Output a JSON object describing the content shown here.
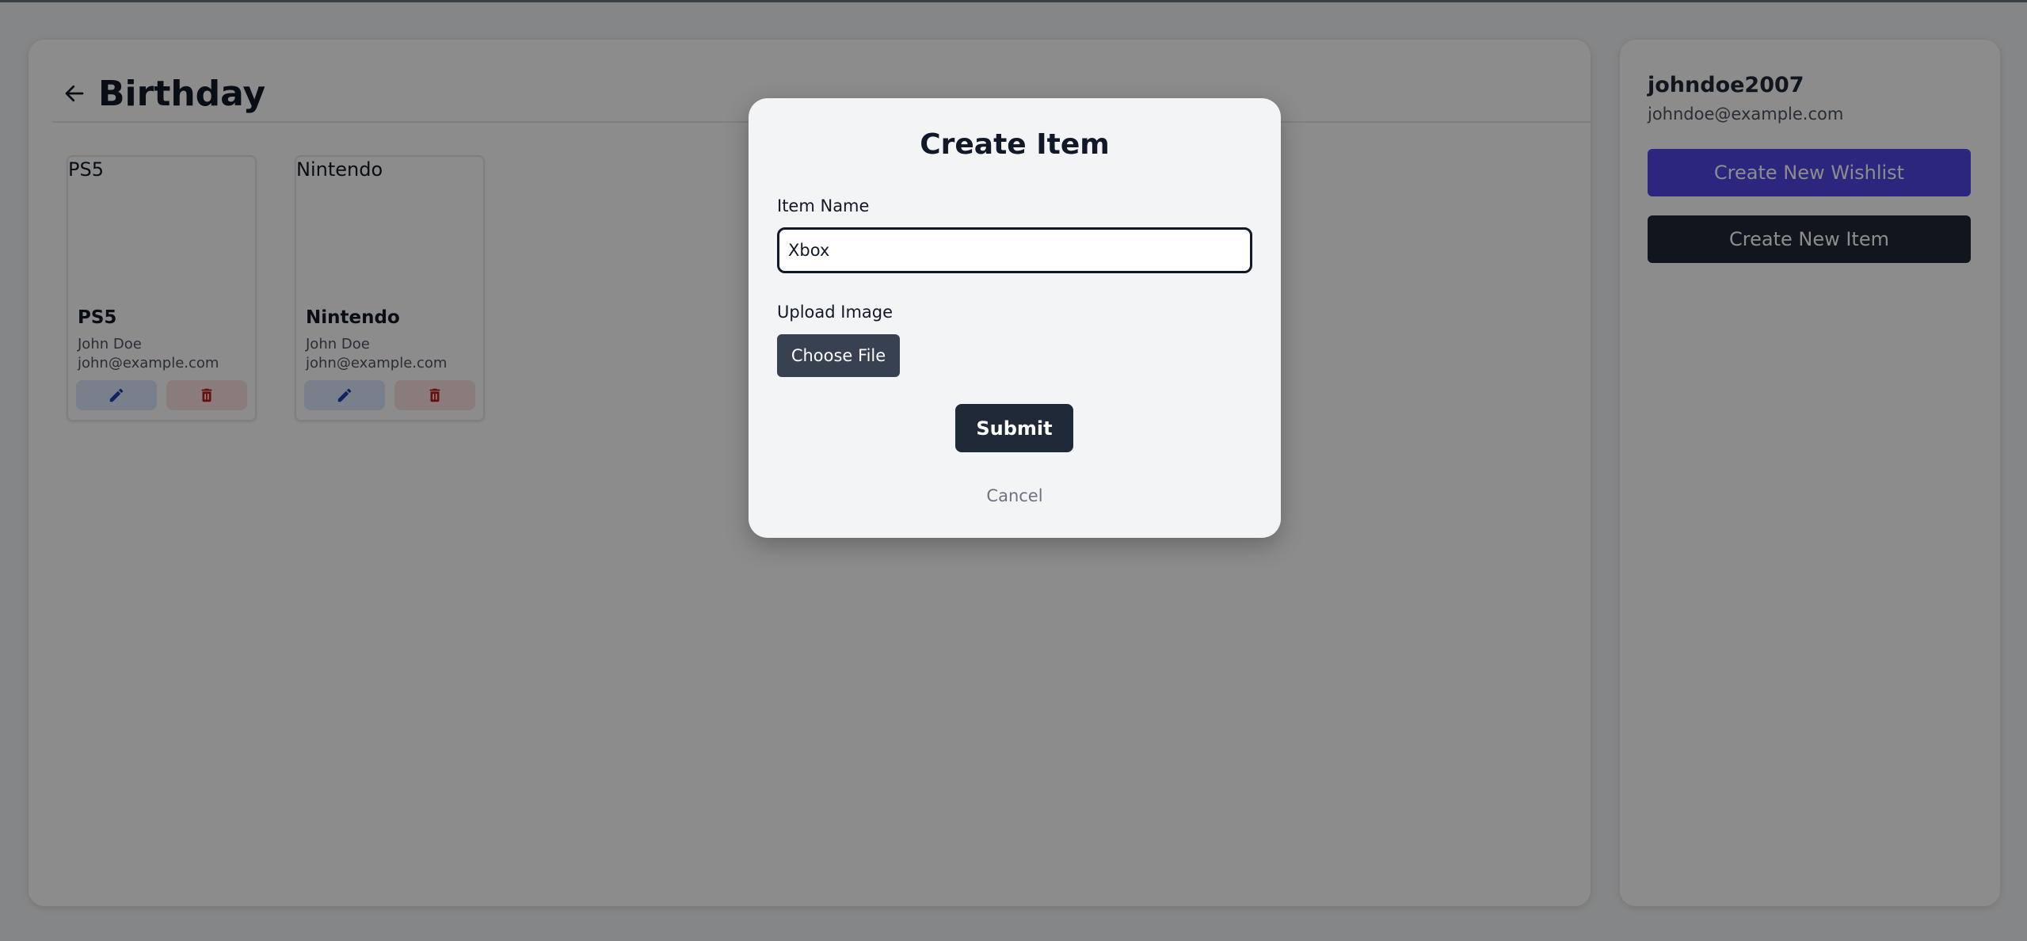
{
  "page": {
    "title": "Birthday"
  },
  "items": [
    {
      "image_alt": "PS5",
      "name": "PS5",
      "owner": "John Doe",
      "email": "john@example.com"
    },
    {
      "image_alt": "Nintendo",
      "name": "Nintendo",
      "owner": "John Doe",
      "email": "john@example.com"
    }
  ],
  "sidebar": {
    "username": "johndoe2007",
    "email": "johndoe@example.com",
    "create_wishlist_label": "Create New Wishlist",
    "create_item_label": "Create New Item"
  },
  "modal": {
    "title": "Create Item",
    "item_name_label": "Item Name",
    "item_name_value": "Xbox",
    "upload_label": "Upload Image",
    "choose_file_label": "Choose File",
    "submit_label": "Submit",
    "cancel_label": "Cancel"
  },
  "icons": {
    "back": "arrow-left-icon",
    "edit": "pencil-icon",
    "delete": "trash-icon"
  },
  "colors": {
    "primary_indigo": "#4f46e5",
    "dark": "#1f2937",
    "edit_icon": "#1e40af",
    "delete_icon": "#b91c1c"
  }
}
